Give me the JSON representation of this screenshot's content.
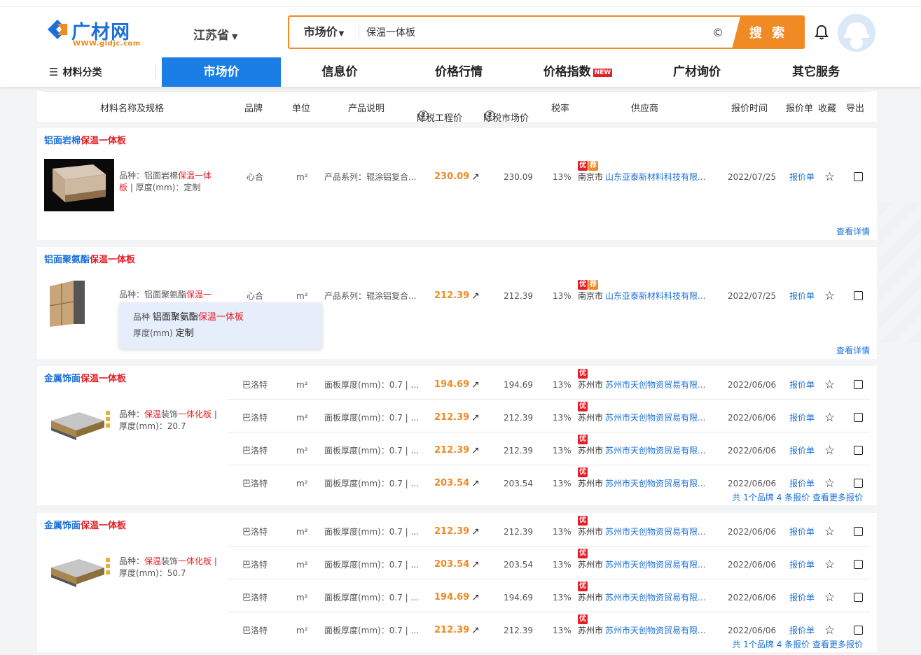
{
  "brand": {
    "name": "广材网",
    "url": "WWW.gldjc.com"
  },
  "region": {
    "label": "江苏省"
  },
  "search": {
    "type": "市场价",
    "value": "保温一体板",
    "clear": "©",
    "button": "搜 索"
  },
  "nav": {
    "category": "材料分类",
    "items": [
      {
        "label": "市场价",
        "active": true
      },
      {
        "label": "信息价"
      },
      {
        "label": "价格行情"
      },
      {
        "label": "价格指数",
        "badge": "NEW"
      },
      {
        "label": "广材询价"
      },
      {
        "label": "其它服务"
      }
    ]
  },
  "columns": {
    "name": "材料名称及规格",
    "brand": "品牌",
    "unit": "单位",
    "desc": "产品说明",
    "eng_price": "除税工程价",
    "mkt_price": "除税市场价",
    "tax": "税率",
    "supplier": "供应商",
    "time": "报价时间",
    "quote": "报价单",
    "fav": "收藏",
    "export": "导出",
    "help": "?"
  },
  "labels": {
    "detail": "查看详情",
    "you": "优",
    "jian": "荐"
  },
  "tooltip": {
    "k1": "品种",
    "v1a": "铝面聚氨酯",
    "v1b": "保温一体板",
    "k2": "厚度(mm)",
    "v2": "定制"
  },
  "products": [
    {
      "title_a": "铝面岩棉",
      "title_b": "保温一体板",
      "spec_a": "品种：铝面岩棉",
      "spec_b": "保温一体",
      "spec_c": "板",
      "spec_d": " | 厚度(mm)：定制",
      "row": {
        "brand": "心合",
        "unit": "m²",
        "desc": "产品系列：辊涂铝复合...",
        "price": "230.09",
        "mprice": "230.09",
        "tax": "13%",
        "city": "南京市",
        "supplier": "山东亚泰新材料科技有限...",
        "date": "2022/07/25",
        "quote": "报价单"
      }
    },
    {
      "title_a": "铝面聚氨酯",
      "title_b": "保温一体板",
      "spec_a": "品种：铝面聚氨酯",
      "spec_b": "保温一",
      "row": {
        "brand": "心合",
        "unit": "m²",
        "desc": "产品系列：辊涂铝复合...",
        "price": "212.39",
        "mprice": "212.39",
        "tax": "13%",
        "city": "南京市",
        "supplier": "山东亚泰新材料科技有限...",
        "date": "2022/07/25",
        "quote": "报价单"
      }
    },
    {
      "title_a": "金属饰面",
      "title_b": "保温一体板",
      "spec_a": "品种：",
      "spec_b": "保温",
      "spec_m": "装饰",
      "spec_c": "一体化板",
      "spec_d": " | ",
      "spec_e": "厚度(mm)：20.7",
      "more": "共 1个品牌 4 条报价 查看更多报价",
      "rows": [
        {
          "brand": "巴洛特",
          "unit": "m²",
          "desc": "面板厚度(mm)：0.7 | ...",
          "price": "194.69",
          "mprice": "194.69",
          "tax": "13%",
          "city": "苏州市",
          "supplier": "苏州市天创物资贸易有限...",
          "date": "2022/06/06",
          "quote": "报价单"
        },
        {
          "brand": "巴洛特",
          "unit": "m²",
          "desc": "面板厚度(mm)：0.7 | ...",
          "price": "212.39",
          "mprice": "212.39",
          "tax": "13%",
          "city": "苏州市",
          "supplier": "苏州市天创物资贸易有限...",
          "date": "2022/06/06",
          "quote": "报价单"
        },
        {
          "brand": "巴洛特",
          "unit": "m²",
          "desc": "面板厚度(mm)：0.7 | ...",
          "price": "212.39",
          "mprice": "212.39",
          "tax": "13%",
          "city": "苏州市",
          "supplier": "苏州市天创物资贸易有限...",
          "date": "2022/06/06",
          "quote": "报价单"
        },
        {
          "brand": "巴洛特",
          "unit": "m²",
          "desc": "面板厚度(mm)：0.7 | ...",
          "price": "203.54",
          "mprice": "203.54",
          "tax": "13%",
          "city": "苏州市",
          "supplier": "苏州市天创物资贸易有限...",
          "date": "2022/06/06",
          "quote": "报价单"
        }
      ]
    },
    {
      "title_a": "金属饰面",
      "title_b": "保温一体板",
      "spec_a": "品种：",
      "spec_b": "保温",
      "spec_m": "装饰",
      "spec_c": "一体化板",
      "spec_d": " | ",
      "spec_e": "厚度(mm)：50.7",
      "more": "共 1个品牌 4 条报价 查看更多报价",
      "rows": [
        {
          "brand": "巴洛特",
          "unit": "m²",
          "desc": "面板厚度(mm)：0.7 | ...",
          "price": "212.39",
          "mprice": "212.39",
          "tax": "13%",
          "city": "苏州市",
          "supplier": "苏州市天创物资贸易有限...",
          "date": "2022/06/06",
          "quote": "报价单"
        },
        {
          "brand": "巴洛特",
          "unit": "m²",
          "desc": "面板厚度(mm)：0.7 | ...",
          "price": "203.54",
          "mprice": "203.54",
          "tax": "13%",
          "city": "苏州市",
          "supplier": "苏州市天创物资贸易有限...",
          "date": "2022/06/06",
          "quote": "报价单"
        },
        {
          "brand": "巴洛特",
          "unit": "m²",
          "desc": "面板厚度(mm)：0.7 | ...",
          "price": "194.69",
          "mprice": "194.69",
          "tax": "13%",
          "city": "苏州市",
          "supplier": "苏州市天创物资贸易有限...",
          "date": "2022/06/06",
          "quote": "报价单"
        },
        {
          "brand": "巴洛特",
          "unit": "m²",
          "desc": "面板厚度(mm)：0.7 | ...",
          "price": "212.39",
          "mprice": "212.39",
          "tax": "13%",
          "city": "苏州市",
          "supplier": "苏州市天创物资贸易有限...",
          "date": "2022/06/06",
          "quote": "报价单"
        }
      ]
    }
  ],
  "colors": {
    "accent": "#f08a24",
    "primary": "#1a7ee6",
    "link": "#1a6fd8",
    "highlight": "#e41e24"
  }
}
